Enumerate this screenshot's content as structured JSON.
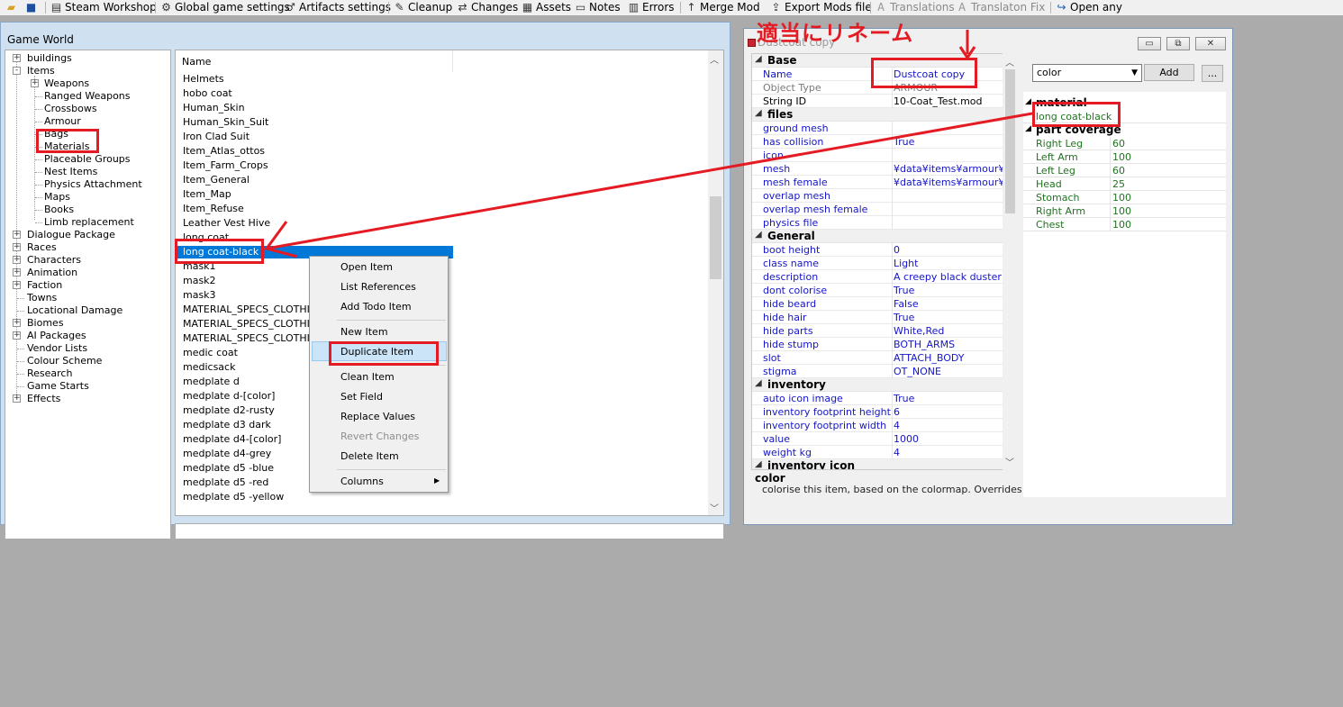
{
  "toolbar": {
    "items": [
      {
        "label": "",
        "icon": "open-folder-icon"
      },
      {
        "label": "",
        "icon": "save-icon"
      },
      {
        "label": "Steam Workshop",
        "icon": "steam-icon"
      },
      {
        "label": "Global game settings",
        "icon": "gear-icon"
      },
      {
        "label": "Artifacts settings",
        "icon": "artifact-icon"
      },
      {
        "label": "Cleanup",
        "icon": "broom-icon"
      },
      {
        "label": "Changes",
        "icon": "changes-icon"
      },
      {
        "label": "Assets",
        "icon": "assets-icon"
      },
      {
        "label": "Notes",
        "icon": "notes-icon"
      },
      {
        "label": "Errors",
        "icon": "errors-icon"
      },
      {
        "label": "Merge Mod",
        "icon": "merge-icon"
      },
      {
        "label": "Export Mods file",
        "icon": "export-icon"
      },
      {
        "label": "Translations",
        "icon": "translations-icon",
        "disabled": true
      },
      {
        "label": "Translaton Fix",
        "icon": "translation-fix-icon",
        "disabled": true
      },
      {
        "label": "Open any",
        "icon": "open-any-icon"
      }
    ]
  },
  "game_world": {
    "title": "Game World",
    "tree": [
      {
        "label": "buildings",
        "expander": "+"
      },
      {
        "label": "Items",
        "expander": "-"
      },
      {
        "label": "Weapons",
        "expander": "+"
      },
      {
        "label": "Ranged Weapons"
      },
      {
        "label": "Crossbows"
      },
      {
        "label": "Armour"
      },
      {
        "label": "Bags"
      },
      {
        "label": "Materials"
      },
      {
        "label": "Placeable Groups"
      },
      {
        "label": "Nest Items"
      },
      {
        "label": "Physics Attachment"
      },
      {
        "label": "Maps"
      },
      {
        "label": "Books"
      },
      {
        "label": "Limb replacement"
      },
      {
        "label": "Dialogue Package",
        "expander": "+"
      },
      {
        "label": "Races",
        "expander": "+"
      },
      {
        "label": "Characters",
        "expander": "+"
      },
      {
        "label": "Animation",
        "expander": "+"
      },
      {
        "label": "Faction",
        "expander": "+"
      },
      {
        "label": "Towns"
      },
      {
        "label": "Locational Damage"
      },
      {
        "label": "Biomes",
        "expander": "+"
      },
      {
        "label": "AI Packages",
        "expander": "+"
      },
      {
        "label": "Vendor Lists"
      },
      {
        "label": "Colour Scheme"
      },
      {
        "label": "Research"
      },
      {
        "label": "Game Starts"
      },
      {
        "label": "Effects",
        "expander": "+"
      }
    ],
    "list_header": "Name",
    "list_items": [
      "Helmets",
      "hobo coat",
      "Human_Skin",
      "Human_Skin_Suit",
      "Iron Clad Suit",
      "Item_Atlas_ottos",
      "Item_Farm_Crops",
      "Item_General",
      "Item_Map",
      "Item_Refuse",
      "Leather Vest Hive",
      "long coat",
      "long coat-black",
      "mask1",
      "mask2",
      "mask3",
      "MATERIAL_SPECS_CLOTHING",
      "MATERIAL_SPECS_CLOTHING2",
      "MATERIAL_SPECS_CLOTHING3",
      "medic coat",
      "medicsack",
      "medplate d",
      "medplate d-[color]",
      "medplate d2-rusty",
      "medplate d3 dark",
      "medplate d4-[color]",
      "medplate d4-grey",
      "medplate d5 -blue",
      "medplate d5 -red",
      "medplate d5 -yellow"
    ],
    "selected_item": "long coat-black"
  },
  "context_menu": {
    "items": [
      {
        "label": "Open Item"
      },
      {
        "label": "List References"
      },
      {
        "label": "Add Todo Item"
      },
      {
        "label": "New Item"
      },
      {
        "label": "Duplicate Item",
        "highlighted": true
      },
      {
        "label": "Clean Item"
      },
      {
        "label": "Set Field"
      },
      {
        "label": "Replace Values"
      },
      {
        "label": "Revert Changes",
        "disabled": true
      },
      {
        "label": "Delete Item"
      },
      {
        "label": "Columns",
        "submenu": true
      }
    ]
  },
  "item_window": {
    "title": "Dustcoat copy",
    "window_buttons": {
      "minimize": "▭",
      "restore": "⧉",
      "close": "✕"
    },
    "sections": [
      {
        "name": "Base",
        "rows": [
          {
            "key": "Name",
            "value": "Dustcoat copy"
          },
          {
            "key": "Object Type",
            "value": "ARMOUR",
            "grey": true
          },
          {
            "key": "String ID",
            "value": "10-Coat_Test.mod",
            "black": true
          }
        ]
      },
      {
        "name": "files",
        "rows": [
          {
            "key": "ground mesh",
            "value": ""
          },
          {
            "key": "has collision",
            "value": "True"
          },
          {
            "key": "icon",
            "value": ""
          },
          {
            "key": "mesh",
            "value": "¥data¥items¥armour¥me"
          },
          {
            "key": "mesh female",
            "value": "¥data¥items¥armour¥me"
          },
          {
            "key": "overlap mesh",
            "value": ""
          },
          {
            "key": "overlap mesh female",
            "value": ""
          },
          {
            "key": "physics file",
            "value": ""
          }
        ]
      },
      {
        "name": "General",
        "rows": [
          {
            "key": "boot height",
            "value": "0"
          },
          {
            "key": "class name",
            "value": "Light"
          },
          {
            "key": "description",
            "value": "A creepy black duster c"
          },
          {
            "key": "dont colorise",
            "value": "True"
          },
          {
            "key": "hide beard",
            "value": "False"
          },
          {
            "key": "hide hair",
            "value": "True"
          },
          {
            "key": "hide parts",
            "value": "White,Red"
          },
          {
            "key": "hide stump",
            "value": "BOTH_ARMS"
          },
          {
            "key": "slot",
            "value": "ATTACH_BODY"
          },
          {
            "key": "stigma",
            "value": "OT_NONE"
          }
        ]
      },
      {
        "name": "inventory",
        "rows": [
          {
            "key": "auto icon image",
            "value": "True"
          },
          {
            "key": "inventory footprint height",
            "value": "6"
          },
          {
            "key": "inventory footprint width",
            "value": "4"
          },
          {
            "key": "value",
            "value": "1000"
          },
          {
            "key": "weight kg",
            "value": "4"
          }
        ]
      },
      {
        "name": "inventory icon",
        "rows": []
      }
    ],
    "description": {
      "title": "color",
      "text": "colorise this item, based on the colormap. Overrides faction coloriser."
    },
    "ref_select": "color",
    "add_button": "Add",
    "more_button": "...",
    "material_section": "material",
    "material_item": "long coat-black",
    "coverage_section": "part coverage",
    "coverage": [
      {
        "part": "Right Leg",
        "value": "60"
      },
      {
        "part": "Left Arm",
        "value": "100"
      },
      {
        "part": "Left Leg",
        "value": "60"
      },
      {
        "part": "Head",
        "value": "25"
      },
      {
        "part": "Stomach",
        "value": "100"
      },
      {
        "part": "Right Arm",
        "value": "100"
      },
      {
        "part": "Chest",
        "value": "100"
      }
    ]
  },
  "annotation": {
    "text": "適当にリネーム",
    "color": "#e41b23"
  }
}
